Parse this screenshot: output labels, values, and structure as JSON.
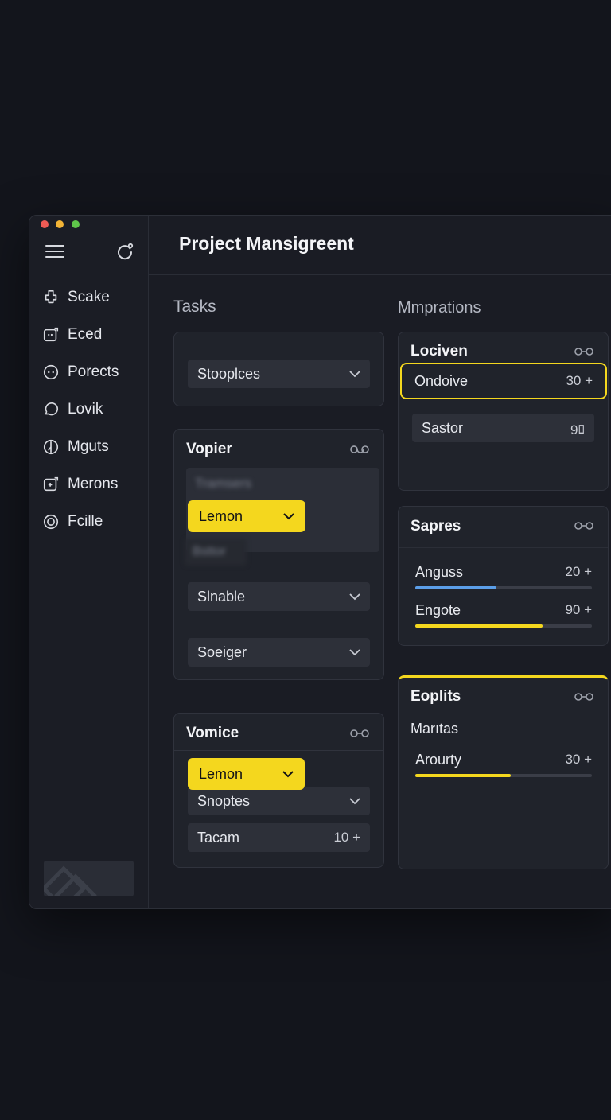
{
  "window": {
    "title": "Project Mansigreent"
  },
  "sidebar": {
    "items": [
      {
        "label": "Scake",
        "icon": "puzzle-icon"
      },
      {
        "label": "Eced",
        "icon": "chat-square-icon"
      },
      {
        "label": "Porects",
        "icon": "face-circle-icon"
      },
      {
        "label": "Lovik",
        "icon": "speech-bubble-icon"
      },
      {
        "label": "Mguts",
        "icon": "compass-icon"
      },
      {
        "label": "Merons",
        "icon": "square-plus-icon"
      },
      {
        "label": "Fcille",
        "icon": "target-icon"
      }
    ]
  },
  "tasks": {
    "heading": "Tasks",
    "card1": {
      "select": "Stooplces"
    },
    "card2": {
      "title": "Vopier",
      "blurred_top": "Tramsers",
      "yellow_select": "Lemon",
      "blurred_bottom": "Bsttor",
      "select1": "Slnable",
      "select2": "Soeiger"
    },
    "card3": {
      "title": "Vomice",
      "yellow_select": "Lemon",
      "select": "Snoptes",
      "row_label": "Tacam",
      "row_value": "10 +"
    }
  },
  "mmprations": {
    "heading": "Mmprations",
    "card1": {
      "title": "Lociven",
      "row1": {
        "label": "Ondoive",
        "value": "30 +"
      },
      "row2": {
        "label": "Sastor",
        "value": "9ﾛ"
      }
    },
    "card2": {
      "title": "Sapres",
      "rows": [
        {
          "label": "Anguss",
          "value": "20 +",
          "progress": 0.46,
          "color": "#5b9ee8"
        },
        {
          "label": "Engote",
          "value": "90 +",
          "progress": 0.72,
          "color": "#f4d71e"
        }
      ]
    },
    "card3": {
      "title": "Eoplits",
      "subtitle": "Marıtas",
      "row": {
        "label": "Arourty",
        "value": "30 +",
        "progress": 0.54,
        "color": "#f4d71e"
      }
    }
  },
  "colors": {
    "accent": "#f4d71e",
    "background": "#13151c",
    "panel": "#20232b"
  }
}
